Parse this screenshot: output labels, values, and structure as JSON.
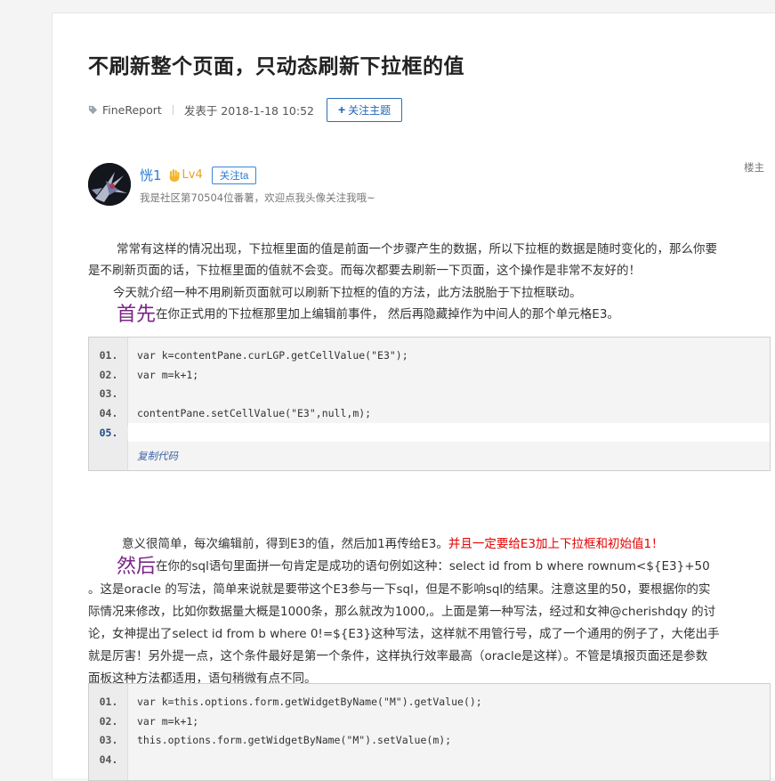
{
  "post": {
    "title": "不刷新整个页面，只动态刷新下拉框的值",
    "tag": "FineReport",
    "published": "发表于 2018-1-18 10:52",
    "follow_topic": "关注主题",
    "floor": "楼主"
  },
  "author": {
    "name": "恍1",
    "level": "Lv4",
    "follow": "关注ta",
    "signature": "我是社区第70504位番薯，欢迎点我头像关注我哦~"
  },
  "body": {
    "p1_line1": "常常有这样的情况出现，下拉框里面的值是前面一个步骤产生的数据，所以下拉框的数据是随时变化的，那么你要",
    "p1_line2": "是不刷新页面的话，下拉框里面的值就不会变。而每次都要去刷新一下页面，这个操作是非常不友好的！",
    "p2": "今天就介绍一种不用刷新页面就可以刷新下拉框的值的方法，此方法脱胎于下拉框联动。",
    "p3_big": "首先",
    "p3_text": "在你正式用的下拉框那里加上编辑前事件， 然后再隐藏掉作为中间人的那个单元格E3。",
    "p4_text": "意义很简单，每次编辑前，得到E3的值，然后加1再传给E3。",
    "p4_red": "并且一定要给E3加上下拉框和初始值1！",
    "p5_big": "然后",
    "p5_line1": "在你的sql语句里面拼一句肯定是成功的语句例如这种：select id from b  where rownum<${E3}+50",
    "p5_line2": "。这是oracle 的写法，简单来说就是要带这个E3参与一下sql，但是不影响sql的结果。注意这里的50，要根据你的实",
    "p5_line3": "际情况来修改，比如你数据量大概是1000条，那么就改为1000,。上面是第一种写法，经过和女神@cherishdqy 的讨",
    "p5_line4": "论，女神提出了select id from b  where 0!=${E3}这种写法，这样就不用管行号，成了一个通用的例子了，大佬出手",
    "p5_line5": "就是厉害！另外提一点，这个条件最好是第一个条件，这样执行效率最高（oracle是这样）。不管是填报页面还是参数",
    "p5_line6": "面板这种方法都适用，语句稍微有点不同。"
  },
  "code1": {
    "lines": [
      {
        "n": "01.",
        "code": "var k=contentPane.curLGP.getCellValue(\"E3\");"
      },
      {
        "n": "02.",
        "code": "var m=k+1;"
      },
      {
        "n": "03.",
        "code": ""
      },
      {
        "n": "04.",
        "code": "contentPane.setCellValue(\"E3\",null,m);"
      },
      {
        "n": "05.",
        "code": ""
      }
    ],
    "copy_label": "复制代码"
  },
  "code2": {
    "lines": [
      {
        "n": "01.",
        "code": "var k=this.options.form.getWidgetByName(\"M\").getValue();"
      },
      {
        "n": "02.",
        "code": "var m=k+1;"
      },
      {
        "n": "03.",
        "code": "this.options.form.getWidgetByName(\"M\").setValue(m);"
      },
      {
        "n": "04.",
        "code": ""
      }
    ]
  },
  "colors": {
    "link": "#2a7bd3",
    "highlight": "#7a2585",
    "warning": "#e60000"
  },
  "icons": {
    "tag": "tag-icon",
    "level": "hand-wave-icon"
  }
}
